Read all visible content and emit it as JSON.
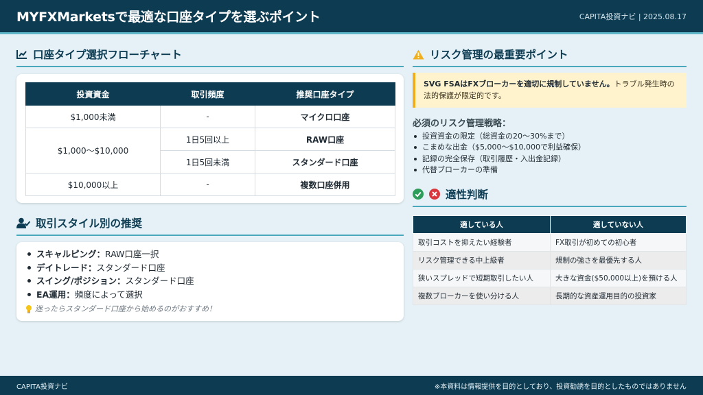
{
  "header": {
    "title": "MYFXMarketsで最適な口座タイプを選ぶポイント",
    "meta": "CAPITA投資ナビ | 2025.08.17"
  },
  "flowchart": {
    "section_title": "口座タイプ選択フローチャート",
    "columns": [
      "投資資金",
      "取引頻度",
      "推奨口座タイプ"
    ],
    "rows": [
      {
        "capital": "$1,000未満",
        "frequency": "-",
        "account": "マイクロ口座"
      },
      {
        "capital": "$1,000〜$10,000",
        "frequency": "1日5回以上",
        "account": "RAW口座"
      },
      {
        "frequency": "1日5回未満",
        "account": "スタンダード口座"
      },
      {
        "capital": "$10,000以上",
        "frequency": "-",
        "account": "複数口座併用"
      }
    ]
  },
  "trading_style": {
    "section_title": "取引スタイル別の推奨",
    "items": [
      {
        "key": "スキャルピング：",
        "value": "RAW口座一択"
      },
      {
        "key": "デイトレード：",
        "value": "スタンダード口座"
      },
      {
        "key": "スイング/ポジション：",
        "value": "スタンダード口座"
      },
      {
        "key": "EA運用：",
        "value": "頻度によって選択"
      }
    ],
    "tip": "迷ったらスタンダード口座から始めるのがおすすめ！"
  },
  "risk": {
    "section_title": "リスク管理の最重要ポイント",
    "warning_bold": "SVG FSAはFXブローカーを適切に規制していません。",
    "warning_text": "トラブル発生時の法的保護が限定的です。",
    "subtitle": "必須のリスク管理戦略：",
    "items": [
      "投資資金の限定（総資金の20〜30%まで）",
      "こまめな出金（$5,000〜$10,000で利益確保）",
      "記録の完全保存（取引履歴・入出金記録）",
      "代替ブローカーの準備"
    ]
  },
  "suitability": {
    "section_title": "適性判断",
    "columns": [
      "適している人",
      "適していない人"
    ],
    "rows": [
      [
        "取引コストを抑えたい経験者",
        "FX取引が初めての初心者"
      ],
      [
        "リスク管理できる中上級者",
        "規制の強さを最優先する人"
      ],
      [
        "狭いスプレッドで短期取引したい人",
        "大きな資金($50,000以上)を預ける人"
      ],
      [
        "複数ブローカーを使い分ける人",
        "長期的な資産運用目的の投資家"
      ]
    ]
  },
  "footer": {
    "left": "CAPITA投資ナビ",
    "right": "※本資料は情報提供を目的としており、投資勧誘を目的としたものではありません"
  },
  "colors": {
    "navy": "#0c3b52",
    "accent": "#4aa8bd",
    "warning": "#f0ad1d",
    "check": "#2e9c5a",
    "cross": "#d9363e"
  },
  "icons": [
    "chart-line-icon",
    "user-check-icon",
    "warning-icon",
    "check-circle-icon",
    "x-circle-icon",
    "lightbulb-icon"
  ]
}
